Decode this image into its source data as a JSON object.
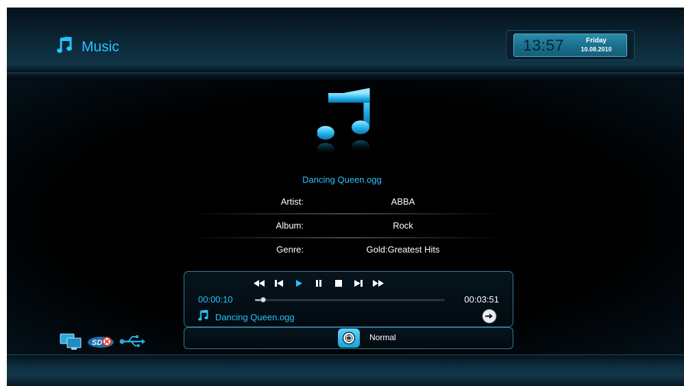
{
  "app": {
    "title": "Music",
    "icon": "music-note-icon"
  },
  "clock": {
    "time": "13:57",
    "day": "Friday",
    "date": "10.08.2010"
  },
  "now_playing": {
    "title": "Dancing Queen.ogg",
    "artwork_icon": "music-note-icon",
    "info": [
      {
        "key": "Artist:",
        "value": "ABBA"
      },
      {
        "key": "Album:",
        "value": "Rock"
      },
      {
        "key": "Genre:",
        "value": "Gold:Greatest Hits"
      }
    ]
  },
  "player": {
    "current_time": "00:00:10",
    "total_time": "00:03:51",
    "progress_fraction": 0.043,
    "track_label": "Dancing Queen.ogg",
    "controls": [
      "rewind-icon",
      "previous-icon",
      "play-icon",
      "pause-icon",
      "stop-icon",
      "next-icon",
      "fast-forward-icon"
    ]
  },
  "mode": {
    "label": "Normal",
    "icon": "repeat-mode-icon"
  },
  "status_icons": [
    "network-icon",
    "sd-card-icon",
    "usb-icon"
  ],
  "colors": {
    "accent": "#27c3ff",
    "panel_border": "#2f7f9c",
    "background": "#000000"
  }
}
